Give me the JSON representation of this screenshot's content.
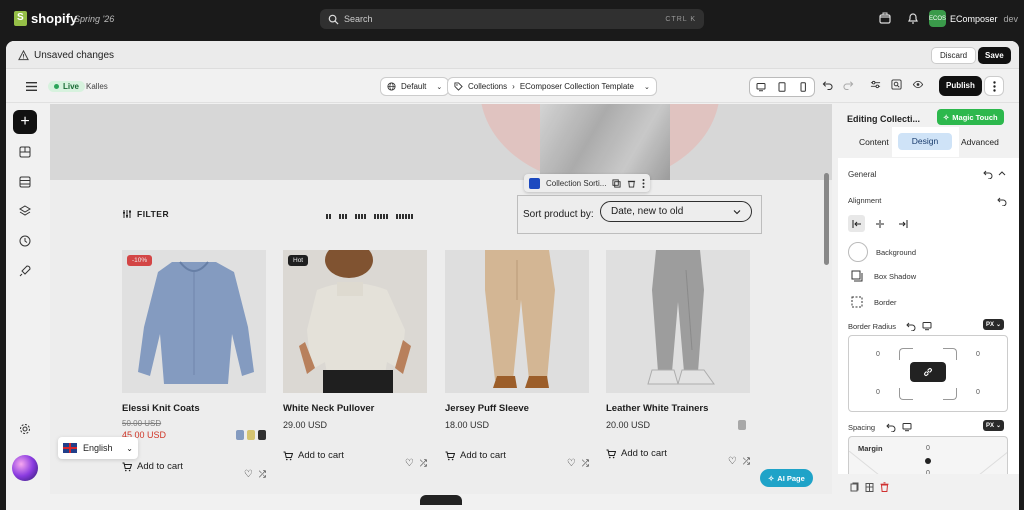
{
  "topbar": {
    "brand": "shopify",
    "season": "Spring '26",
    "search_placeholder": "Search",
    "search_shortcut": "CTRL K",
    "store_initials": "ECOS",
    "store_name": "EComposer",
    "store_env": "dev"
  },
  "unsaved": {
    "message": "Unsaved changes",
    "discard_label": "Discard",
    "save_label": "Save"
  },
  "toolbar": {
    "status": "Live",
    "theme_name": "Kalles",
    "language": "Default",
    "crumb_root": "Collections",
    "crumb_page": "EComposer Collection Template",
    "publish_label": "Publish"
  },
  "canvas": {
    "filter_label": "FILTER",
    "sort_tool_label": "Collection Sorti...",
    "sort_label": "Sort product by:",
    "sort_value": "Date, new to old",
    "cart_label": "Add to cart",
    "language_label": "English",
    "ai_page_label": "AI Page",
    "products": [
      {
        "name": "Elessi Knit Coats",
        "price": "50.00 USD",
        "sale_price": "45.00 USD",
        "badge": "-10%"
      },
      {
        "name": "White Neck Pullover",
        "price": "29.00 USD",
        "badge": "Hot"
      },
      {
        "name": "Jersey Puff Sleeve",
        "price": "18.00 USD"
      },
      {
        "name": "Leather White Trainers",
        "price": "20.00 USD"
      }
    ]
  },
  "panel": {
    "title": "Editing Collecti...",
    "magic_label": "Magic Touch",
    "tab_content": "Content",
    "tab_design": "Design",
    "tab_advanced": "Advanced",
    "section_general": "General",
    "alignment_label": "Alignment",
    "background_label": "Background",
    "box_shadow_label": "Box Shadow",
    "border_label": "Border",
    "border_radius_label": "Border Radius",
    "unit": "PX",
    "radius_tl": "0",
    "radius_tr": "0",
    "radius_bl": "0",
    "radius_br": "0",
    "spacing_label": "Spacing",
    "margin_label": "Margin",
    "margin_top": "0",
    "margin_bottom": "0"
  }
}
